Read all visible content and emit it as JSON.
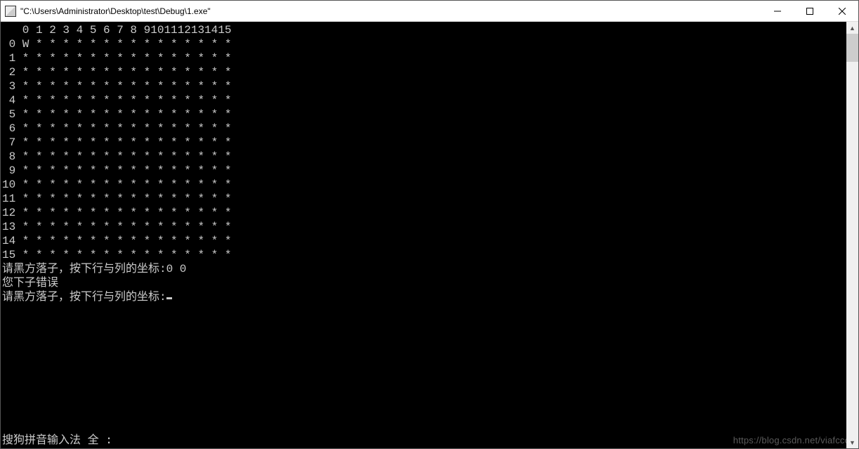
{
  "window": {
    "title": "\"C:\\Users\\Administrator\\Desktop\\test\\Debug\\1.exe\""
  },
  "board": {
    "size": 16,
    "col_labels": [
      " 0",
      " 1",
      " 2",
      " 3",
      " 4",
      " 5",
      " 6",
      " 7",
      " 8",
      " 9",
      "10",
      "11",
      "12",
      "13",
      "14",
      "15"
    ],
    "row_labels": [
      " 0",
      " 1",
      " 2",
      " 3",
      " 4",
      " 5",
      " 6",
      " 7",
      " 8",
      " 9",
      "10",
      "11",
      "12",
      "13",
      "14",
      "15"
    ],
    "cells": {
      "note": "All cells are '*' except row 0 col 0 which is 'W'",
      "piece_at_0_0": "W",
      "empty_char": "*"
    }
  },
  "messages": {
    "prompt_prefix": "请黑方落子，按下行与列的坐标:",
    "prev_input": "0 0",
    "error": "您下子错误"
  },
  "ime": {
    "status": "搜狗拼音输入法  全 :"
  },
  "watermark": {
    "text": "https://blog.csdn.net/viafcccc"
  }
}
